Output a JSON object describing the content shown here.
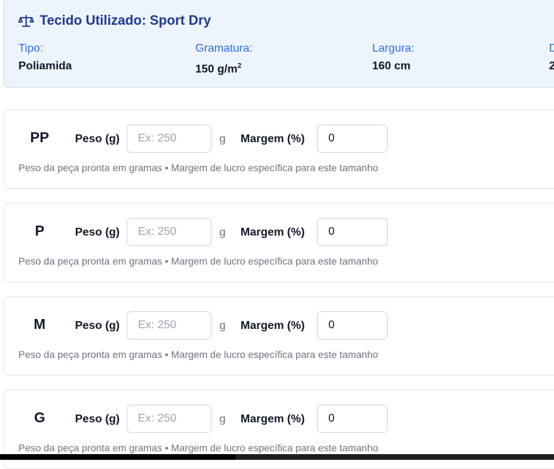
{
  "fabric": {
    "title_prefix": "Tecido Utilizado:",
    "title_name": "Sport Dry",
    "icon": "scale-icon",
    "specs": [
      {
        "label": "Tipo:",
        "value": "Poliamida"
      },
      {
        "label": "Gramatura:",
        "value": "150 g/m",
        "sup": "2"
      },
      {
        "label": "Largura:",
        "value": "160 cm"
      },
      {
        "label": "D",
        "value": "2"
      }
    ]
  },
  "sizes": [
    {
      "label": "PP",
      "peso_label": "Peso (g)",
      "peso_placeholder": "Ex: 250",
      "peso_value": "",
      "unit": "g",
      "margem_label": "Margem (%)",
      "margem_value": "0",
      "hint": "Peso da peça pronta em gramas • Margem de lucro específica para este tamanho"
    },
    {
      "label": "P",
      "peso_label": "Peso (g)",
      "peso_placeholder": "Ex: 250",
      "peso_value": "",
      "unit": "g",
      "margem_label": "Margem (%)",
      "margem_value": "0",
      "hint": "Peso da peça pronta em gramas • Margem de lucro específica para este tamanho"
    },
    {
      "label": "M",
      "peso_label": "Peso (g)",
      "peso_placeholder": "Ex: 250",
      "peso_value": "",
      "unit": "g",
      "margem_label": "Margem (%)",
      "margem_value": "0",
      "hint": "Peso da peça pronta em gramas • Margem de lucro específica para este tamanho"
    },
    {
      "label": "G",
      "peso_label": "Peso (g)",
      "peso_placeholder": "Ex: 250",
      "peso_value": "",
      "unit": "g",
      "margem_label": "Margem (%)",
      "margem_value": "0",
      "hint": "Peso da peça pronta em gramas • Margem de lucro específica para este tamanho"
    }
  ],
  "colors": {
    "fabric_bg": "#eef4fd",
    "fabric_title": "#1e3a8a",
    "spec_label": "#2f6fdc"
  }
}
